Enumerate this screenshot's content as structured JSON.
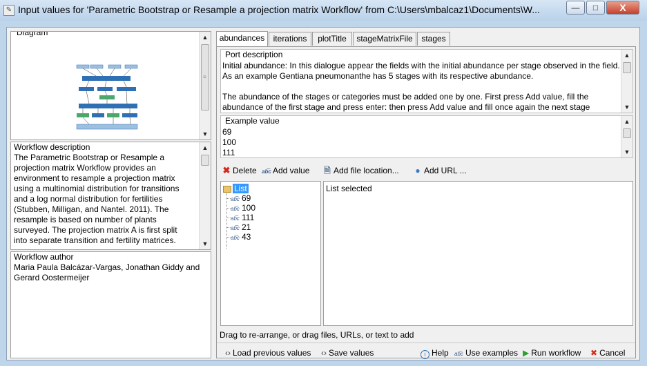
{
  "window": {
    "title": "Input values for 'Parametric Bootstrap or Resample a projection matrix Workflow' from C:\\Users\\mbalcaz1\\Documents\\W...",
    "minimize": "—",
    "maximize": "□",
    "close": "X"
  },
  "left": {
    "diagram_label": "Diagram",
    "description_label": "Workflow description",
    "description_text": "The Parametric Bootstrap or Resample a\nprojection matrix Workflow provides an\nenvironment to resample a projection matrix\nusing a multinomial distribution for transitions\nand a log normal distribution for fertilities\n(Stubben, Milligan, and Nantel. 2011). The\nresample is based on number of plants\nsurveyed. The projection matrix A is first split\ninto separate transition and fertility matrices.",
    "author_label": "Workflow author",
    "author_text": "Maria Paula Balcázar-Vargas, Jonathan Giddy and\nGerard Oostermeijer"
  },
  "tabs": [
    "abundances",
    "iterations",
    "plotTitle",
    "stageMatrixFile",
    "stages"
  ],
  "port": {
    "label": "Port description",
    "text": "Initial abundance: In this dialogue appear the fields with the initial abundance per stage observed in the field.\nAs an example Gentiana pneumonanthe has 5 stages with its respective abundance.\n\nThe abundance of the stages or categories must be added one by one. First press Add value, fill the\nabundance of the first stage and press enter: then press Add value and fill once again the next stage"
  },
  "example": {
    "label": "Example value",
    "text": "69\n100\n111"
  },
  "toolbar": {
    "delete": "Delete",
    "add_value": "Add value",
    "add_file": "Add file location...",
    "add_url": "Add URL ..."
  },
  "tree": {
    "root": "List",
    "items": [
      "69",
      "100",
      "111",
      "21",
      "43"
    ]
  },
  "detail_text": "List selected",
  "hint": "Drag to re-arrange, or drag files, URLs, or text to add",
  "bottom": {
    "load": "Load previous values",
    "save": "Save values",
    "help": "Help",
    "examples": "Use examples",
    "run": "Run workflow",
    "cancel": "Cancel"
  },
  "colors": {
    "accent": "#3399ff",
    "delete": "#d42a1c",
    "run": "#2ea02e",
    "diagram_blue": "#2f6fb3",
    "diagram_green": "#4aa86b"
  },
  "icons": {
    "folder": "folder-icon",
    "text": "abc-text-icon",
    "file": "file-icon",
    "globe": "globe-icon",
    "help": "info-icon",
    "load_save": "arrows-icon"
  }
}
